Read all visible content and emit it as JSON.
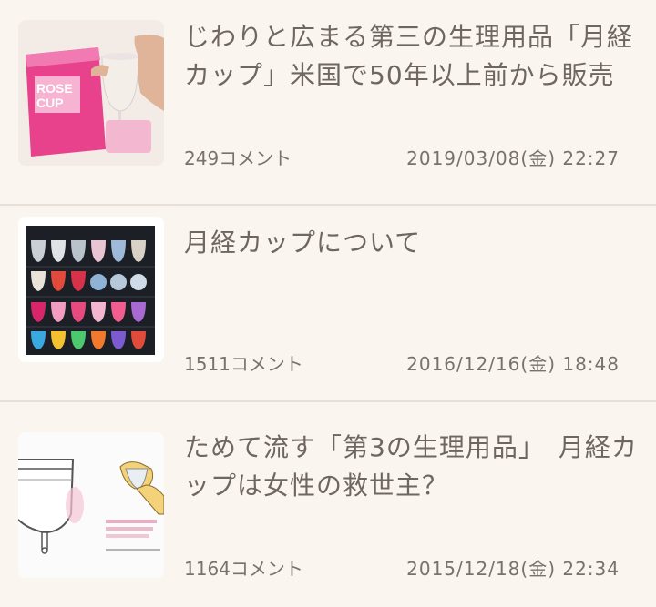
{
  "articles": [
    {
      "title": "じわりと広まる第三の生理用品「月経カップ」米国で50年以上前から販売",
      "comments": "249コメント",
      "date": "2019/03/08(金)  22:27",
      "thumb_text": [
        "ROSE",
        "CUP"
      ]
    },
    {
      "title": "月経カップについて",
      "comments": "1511コメント",
      "date": "2016/12/16(金)  18:48"
    },
    {
      "title": "ためて流す「第3の生理用品」　月経カップは女性の救世主？",
      "comments": "1164コメント",
      "date": "2015/12/18(金)  22:34"
    }
  ],
  "colors": {
    "background": "#faf5ef",
    "divider": "#e7dfd8",
    "text": "#6f6660",
    "accent_pink": "#e8428c"
  }
}
